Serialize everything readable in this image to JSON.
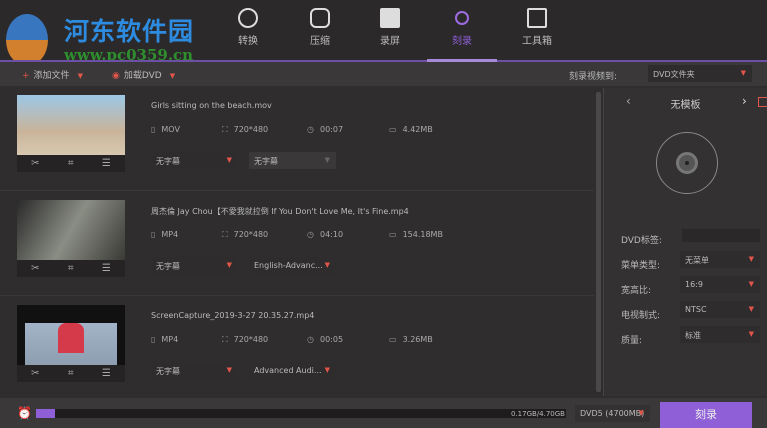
{
  "watermark": {
    "name": "河东软件园",
    "url": "www.pc0359.cn"
  },
  "tabs": [
    {
      "label": "转换",
      "icon": "play-circle-icon"
    },
    {
      "label": "压缩",
      "icon": "compress-icon"
    },
    {
      "label": "录屏",
      "icon": "camera-icon"
    },
    {
      "label": "刻录",
      "icon": "disc-burn-icon",
      "active": true
    },
    {
      "label": "工具箱",
      "icon": "toolbox-icon"
    }
  ],
  "toolbar": {
    "add_file": "添加文件",
    "load_dvd": "加载DVD",
    "burn_to_label": "刻录视频到:",
    "burn_to_value": "DVD文件夹"
  },
  "files": [
    {
      "name": "Girls sitting on the beach.mov",
      "format": "MOV",
      "resolution": "720*480",
      "duration": "00:07",
      "size": "4.42MB",
      "subtitle": "无字幕",
      "audio": "无字幕"
    },
    {
      "name": "周杰倫 Jay Chou【不愛我就拉倒 If You Don't Love Me, It's Fine.mp4",
      "format": "MP4",
      "resolution": "720*480",
      "duration": "04:10",
      "size": "154.18MB",
      "subtitle": "无字幕",
      "audio": "English-Advanc..."
    },
    {
      "name": "ScreenCapture_2019-3-27 20.35.27.mp4",
      "format": "MP4",
      "resolution": "720*480",
      "duration": "00:05",
      "size": "3.26MB",
      "subtitle": "无字幕",
      "audio": "Advanced Audi..."
    }
  ],
  "panel": {
    "template": "无模板",
    "dvd_label": "DVD标签:",
    "dvd_label_value": "",
    "menu_type_label": "菜单类型:",
    "menu_type": "无菜单",
    "aspect_label": "宽高比:",
    "aspect": "16:9",
    "tv_label": "电视制式:",
    "tv": "NTSC",
    "quality_label": "质量:",
    "quality": "标准"
  },
  "bottom": {
    "usage": "0.17GB/4.70GB",
    "usage_fraction": 0.036,
    "disc_type": "DVD5 (4700MB)",
    "burn_button": "刻录"
  },
  "colors": {
    "accent": "#8e5fd6",
    "arrow": "#e2554a"
  }
}
